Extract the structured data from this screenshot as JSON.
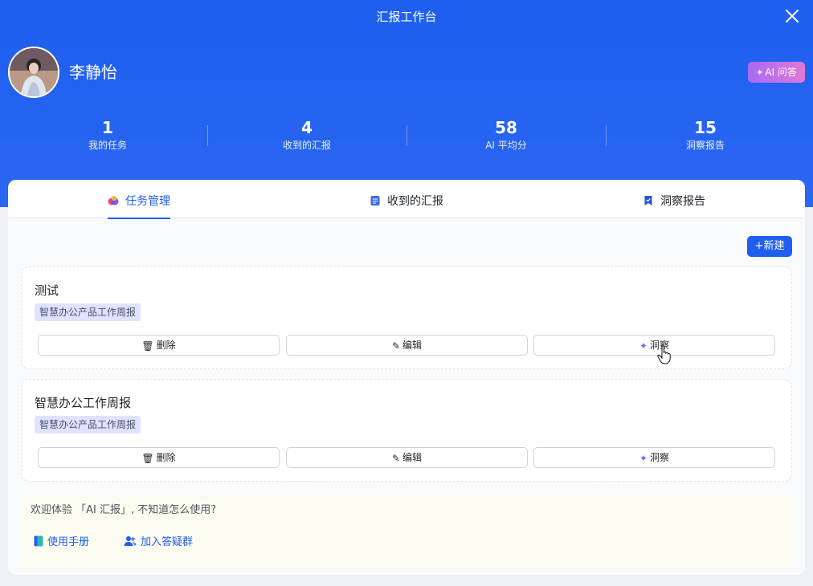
{
  "header": {
    "title": "汇报工作台",
    "user_name": "李静怡",
    "ai_qa_label": "AI 问答"
  },
  "stats": [
    {
      "value": "1",
      "label": "我的任务"
    },
    {
      "value": "4",
      "label": "收到的汇报"
    },
    {
      "value": "58",
      "label": "AI 平均分"
    },
    {
      "value": "15",
      "label": "洞察报告"
    }
  ],
  "tabs": [
    {
      "label": "任务管理",
      "icon": "task-icon",
      "active": true
    },
    {
      "label": "收到的汇报",
      "icon": "doc-icon",
      "active": false
    },
    {
      "label": "洞察报告",
      "icon": "bookmark-icon",
      "active": false
    }
  ],
  "new_button_label": "新建",
  "tasks": [
    {
      "title": "测试",
      "tag": "智慧办公产品工作周报",
      "delete_label": "删除",
      "edit_label": "编辑",
      "insight_label": "洞察"
    },
    {
      "title": "智慧办公工作周报",
      "tag": "智慧办公产品工作周报",
      "delete_label": "删除",
      "edit_label": "编辑",
      "insight_label": "洞察"
    }
  ],
  "welcome": {
    "text": "欢迎体验 「AI 汇报」, 不知道怎么使用?",
    "manual_label": "使用手册",
    "group_label": "加入答疑群"
  },
  "colors": {
    "primary": "#1f5fef",
    "ai_gradient_start": "#a66bf5",
    "ai_gradient_end": "#e178d6"
  }
}
